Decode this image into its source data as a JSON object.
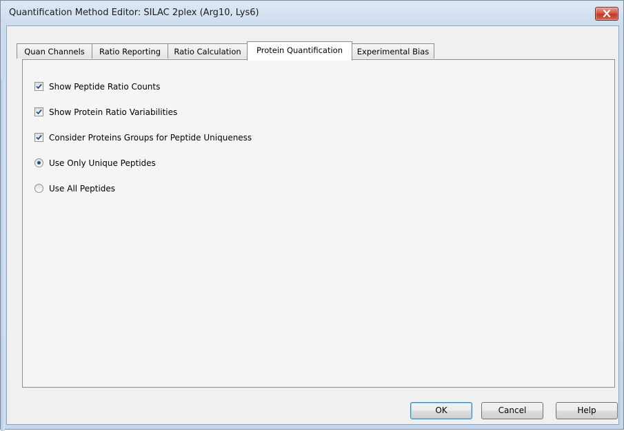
{
  "window": {
    "title": "Quantification Method Editor: SILAC 2plex (Arg10, Lys6)"
  },
  "tabs": [
    {
      "label": "Quan Channels",
      "active": false
    },
    {
      "label": "Ratio Reporting",
      "active": false
    },
    {
      "label": "Ratio Calculation",
      "active": false
    },
    {
      "label": "Protein Quantification",
      "active": true
    },
    {
      "label": "Experimental Bias",
      "active": false
    }
  ],
  "options": {
    "show_peptide_ratio_counts": {
      "label": "Show Peptide Ratio Counts",
      "checked": true
    },
    "show_protein_ratio_variabilities": {
      "label": "Show Protein Ratio Variabilities",
      "checked": true
    },
    "consider_protein_groups": {
      "label": "Consider Proteins Groups for Peptide Uniqueness",
      "checked": true
    },
    "use_only_unique_peptides": {
      "label": "Use Only Unique Peptides",
      "selected": true
    },
    "use_all_peptides": {
      "label": "Use All Peptides",
      "selected": false
    }
  },
  "buttons": {
    "ok": "OK",
    "cancel": "Cancel",
    "help": "Help"
  },
  "colors": {
    "accent": "#1f4f91",
    "close_button": "#c2371e"
  }
}
